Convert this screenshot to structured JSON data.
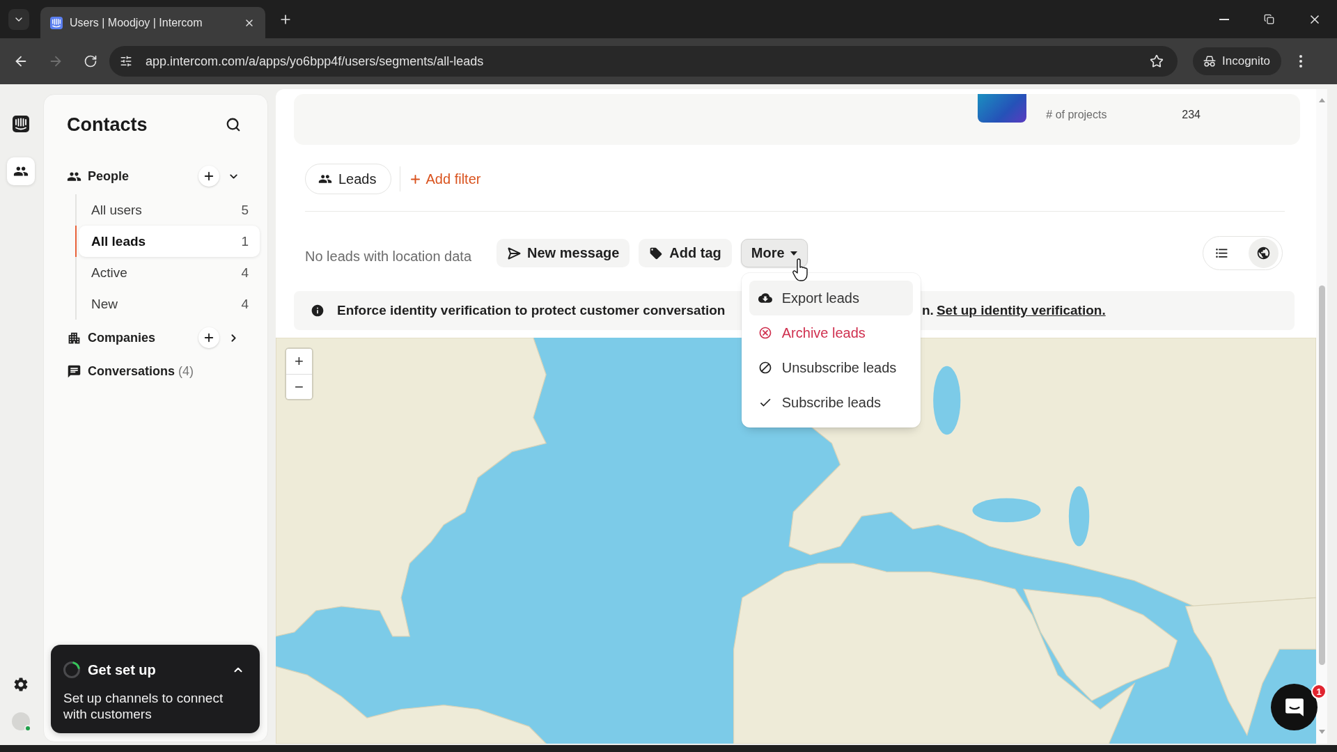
{
  "browser": {
    "tab": {
      "title": "Users | Moodjoy | Intercom",
      "selected": true
    },
    "forward_disabled": true,
    "url": "app.intercom.com/a/apps/yo6bpp4f/users/segments/all-leads",
    "profile_label": "Incognito"
  },
  "rail": {
    "items": [
      {
        "kind": "logo",
        "selected": false
      },
      {
        "kind": "contacts",
        "selected": true
      }
    ],
    "user_online": true
  },
  "sidebar": {
    "title": "Contacts",
    "sections": [
      {
        "kind": "group",
        "label": "People",
        "expanded": true,
        "segments": [
          {
            "label": "All users",
            "count": "5",
            "selected": false
          },
          {
            "label": "All leads",
            "count": "1",
            "selected": true
          },
          {
            "label": "Active",
            "count": "4",
            "selected": false
          },
          {
            "label": "New",
            "count": "4",
            "selected": false
          }
        ]
      },
      {
        "kind": "group",
        "label": "Companies",
        "expanded": false
      },
      {
        "kind": "link",
        "label": "Conversations",
        "count": "(4)"
      }
    ]
  },
  "setup_card": {
    "title": "Get set up",
    "text": "Set up channels to connect with customers",
    "expanded": true
  },
  "summary_card": {
    "stat_label": "# of projects",
    "stat_value": "234"
  },
  "filters": {
    "segment": "Leads",
    "add_filter": "Add filter"
  },
  "actions": {
    "status": "No leads with location data",
    "new_message": "New message",
    "add_tag": "Add tag",
    "more": {
      "label": "More",
      "expanded": true
    }
  },
  "view_toggle": [
    {
      "selected": false
    },
    {
      "selected": true
    }
  ],
  "more_menu": [
    {
      "label": "Export leads",
      "kind": "default",
      "highlighted": true
    },
    {
      "label": "Archive leads",
      "kind": "danger",
      "highlighted": false
    },
    {
      "label": "Unsubscribe leads",
      "kind": "default",
      "highlighted": false
    },
    {
      "label": "Subscribe leads",
      "kind": "default",
      "highlighted": false
    }
  ],
  "banner": {
    "text": "Enforce identity verification to protect customer conversation",
    "text_end": "n.",
    "link": "Set up identity verification."
  },
  "map": {
    "zoom_in": "+",
    "zoom_out": "−"
  },
  "messenger": {
    "badge": "1"
  }
}
